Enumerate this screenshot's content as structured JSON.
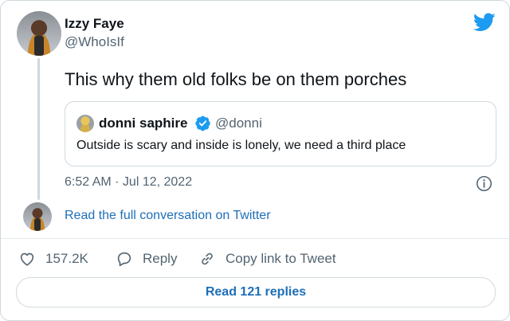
{
  "author": {
    "name": "Izzy Faye",
    "handle": "@WhoIsIf"
  },
  "tweet": {
    "text": "This why them old folks be on them porches",
    "timestamp": "6:52 AM · Jul 12, 2022"
  },
  "quote": {
    "name": "donni saphire",
    "handle": "@donni",
    "text": "Outside is scary and inside is lonely, we need a third place"
  },
  "conversation_link": "Read the full conversation on Twitter",
  "actions": {
    "likes": "157.2K",
    "reply_label": "Reply",
    "copy_label": "Copy link to Tweet"
  },
  "read_replies_label": "Read 121 replies",
  "colors": {
    "twitter_blue": "#1d9bf0",
    "link_blue": "#1d6fb8",
    "muted": "#536471"
  },
  "icons": [
    "twitter-bird-icon",
    "verified-badge-icon",
    "info-icon",
    "heart-icon",
    "reply-bubble-icon",
    "link-icon"
  ]
}
